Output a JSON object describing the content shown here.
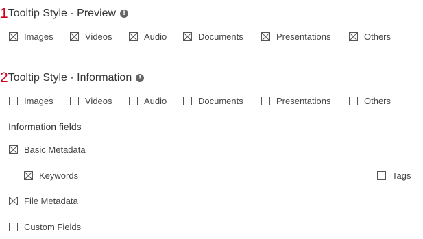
{
  "preview": {
    "number": "1",
    "title": "Tooltip Style - Preview",
    "options": [
      {
        "label": "Images",
        "checked": true
      },
      {
        "label": "Videos",
        "checked": true
      },
      {
        "label": "Audio",
        "checked": true
      },
      {
        "label": "Documents",
        "checked": true
      },
      {
        "label": "Presentations",
        "checked": true
      },
      {
        "label": "Others",
        "checked": true
      }
    ]
  },
  "information": {
    "number": "2",
    "title": "Tooltip Style - Information",
    "options": [
      {
        "label": "Images",
        "checked": false
      },
      {
        "label": "Videos",
        "checked": false
      },
      {
        "label": "Audio",
        "checked": false
      },
      {
        "label": "Documents",
        "checked": false
      },
      {
        "label": "Presentations",
        "checked": false
      },
      {
        "label": "Others",
        "checked": false
      }
    ]
  },
  "fields": {
    "heading": "Information fields",
    "basic_metadata": {
      "label": "Basic Metadata",
      "checked": true
    },
    "keywords": {
      "label": "Keywords",
      "checked": true
    },
    "tags": {
      "label": "Tags",
      "checked": false
    },
    "file_metadata": {
      "label": "File Metadata",
      "checked": true
    },
    "custom_fields": {
      "label": "Custom Fields",
      "checked": false
    }
  },
  "icons": {
    "info": "info-icon",
    "info_glyph": "!"
  },
  "colors": {
    "section_number": "#d0021b",
    "info_icon": "#666666",
    "checkbox_border": "#555555",
    "divider": "#e2e2e2"
  }
}
